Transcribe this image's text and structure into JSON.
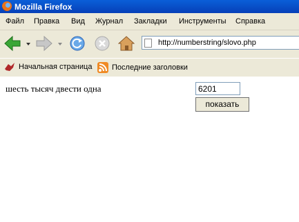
{
  "window": {
    "title": "Mozilla Firefox"
  },
  "menu": [
    "Файл",
    "Правка",
    "Вид",
    "Журнал",
    "Закладки",
    "Инструменты",
    "Справка"
  ],
  "url": "http://numberstring/slovo.php",
  "bookmarks": [
    "Начальная страница",
    "Последние заголовки"
  ],
  "page": {
    "phrase": "шесть тысяч двести одна",
    "input_value": "6201",
    "button_label": "показать"
  }
}
